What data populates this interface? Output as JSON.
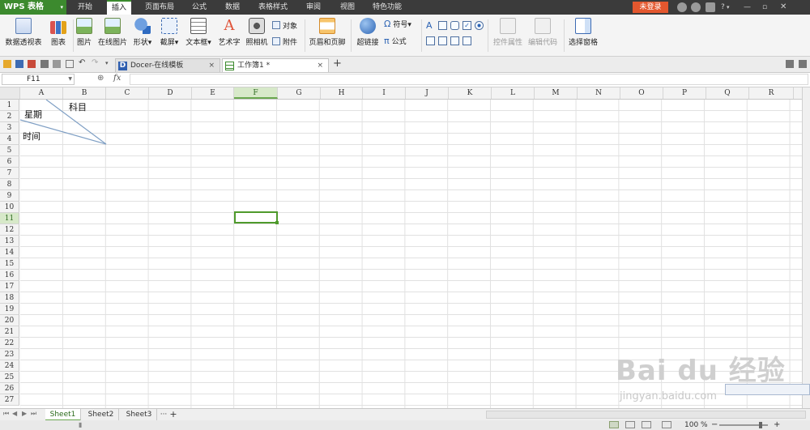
{
  "app": {
    "name": "WPS 表格"
  },
  "menu": {
    "items": [
      "开始",
      "插入",
      "页面布局",
      "公式",
      "数据",
      "表格样式",
      "审阅",
      "视图",
      "特色功能"
    ],
    "active_index": 1,
    "login": "未登录",
    "help": "?"
  },
  "ribbon": {
    "pivot": "数据透视表",
    "chart": "图表",
    "picture": "图片",
    "online_picture": "在线图片",
    "shape": "形状",
    "screenshot": "截屏",
    "textbox": "文本框",
    "wordart": "艺术字",
    "camera": "照相机",
    "object": "对象",
    "attachment": "附件",
    "header_footer": "页眉和页脚",
    "hyperlink": "超链接",
    "symbol": "符号",
    "formula": "公式",
    "control_props": "控件属性",
    "edit_code": "编辑代码",
    "selection_pane": "选择窗格"
  },
  "tabs": {
    "docer": "Docer-在线模板",
    "workbook": "工作簿1 *",
    "close_glyph": "×",
    "new_tab": "+"
  },
  "formula_bar": {
    "cell_ref": "F11",
    "fx": "fx",
    "value": ""
  },
  "grid": {
    "columns": [
      "A",
      "B",
      "C",
      "D",
      "E",
      "F",
      "G",
      "H",
      "I",
      "J",
      "K",
      "L",
      "M",
      "N",
      "O",
      "P",
      "Q",
      "R"
    ],
    "rows": [
      "1",
      "2",
      "3",
      "4",
      "5",
      "6",
      "7",
      "8",
      "9",
      "10",
      "11",
      "12",
      "13",
      "14",
      "15",
      "16",
      "17",
      "18",
      "19",
      "20",
      "21",
      "22",
      "23",
      "24",
      "25",
      "26",
      "27"
    ],
    "selected_col": "F",
    "selected_row": "11",
    "cell_texts": {
      "subject": "科目",
      "weekday": "星期",
      "time": "时间"
    }
  },
  "sheets": {
    "tabs": [
      "Sheet1",
      "Sheet2",
      "Sheet3"
    ],
    "active": 0,
    "more": "···",
    "add": "+"
  },
  "status": {
    "zoom": "100 %"
  },
  "watermark": {
    "logo": "Bai du 经验",
    "url": "jingyan.baidu.com"
  },
  "colors": {
    "brand": "#3c8a2e",
    "login": "#e4572e",
    "selection": "#4f9a2c"
  }
}
